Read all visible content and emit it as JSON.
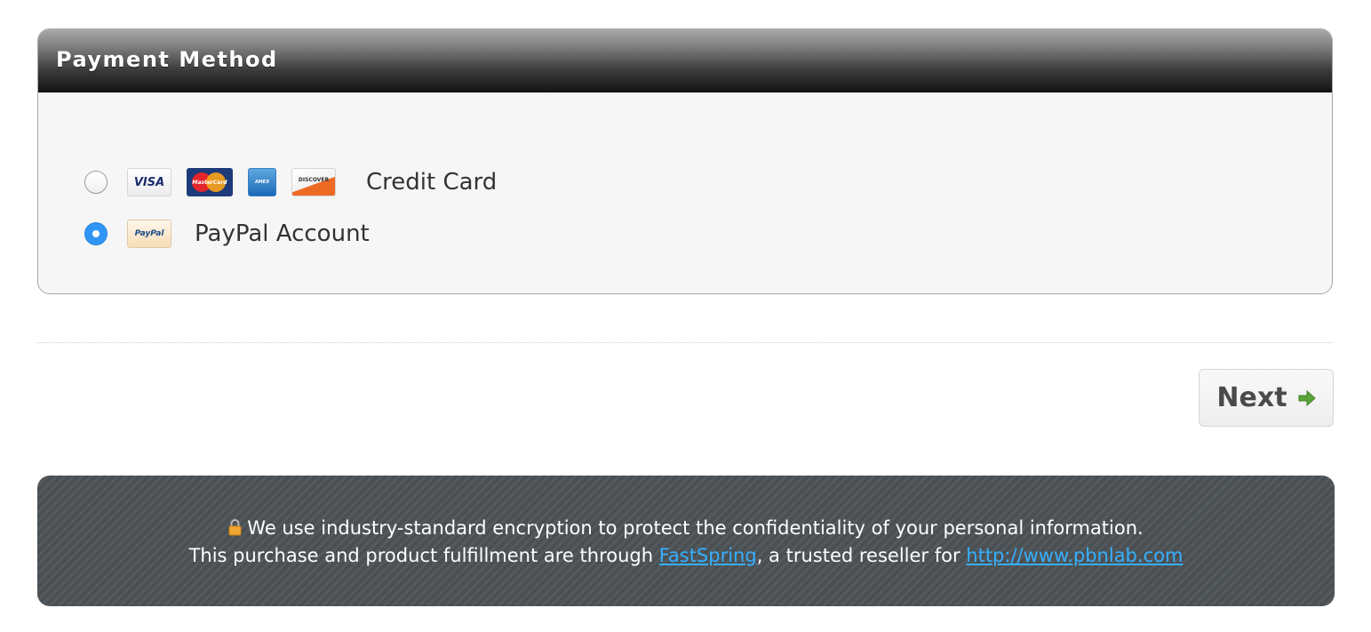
{
  "payment": {
    "title": "Payment Method",
    "options": [
      {
        "label": "Credit Card",
        "selected": false,
        "logos": [
          "VISA",
          "MasterCard",
          "AMEX",
          "DISCOVER"
        ]
      },
      {
        "label": "PayPal Account",
        "selected": true,
        "logos": [
          "PayPal"
        ]
      }
    ]
  },
  "actions": {
    "next_label": "Next",
    "next_icon": "arrow-right-icon"
  },
  "footer": {
    "line1": "We use industry-standard encryption to protect the confidentiality of your personal information.",
    "line2_prefix": "This purchase and product fulfillment are through ",
    "fastspring_link": "FastSpring",
    "line2_middle": ", a trusted reseller for ",
    "site_link": "http://www.pbnlab.com",
    "lock_icon": "lock-icon"
  },
  "colors": {
    "accent_blue": "#2f95f5",
    "link_blue": "#35b0ff",
    "arrow_green": "#5aa538",
    "footer_bg": "#4d5256"
  }
}
